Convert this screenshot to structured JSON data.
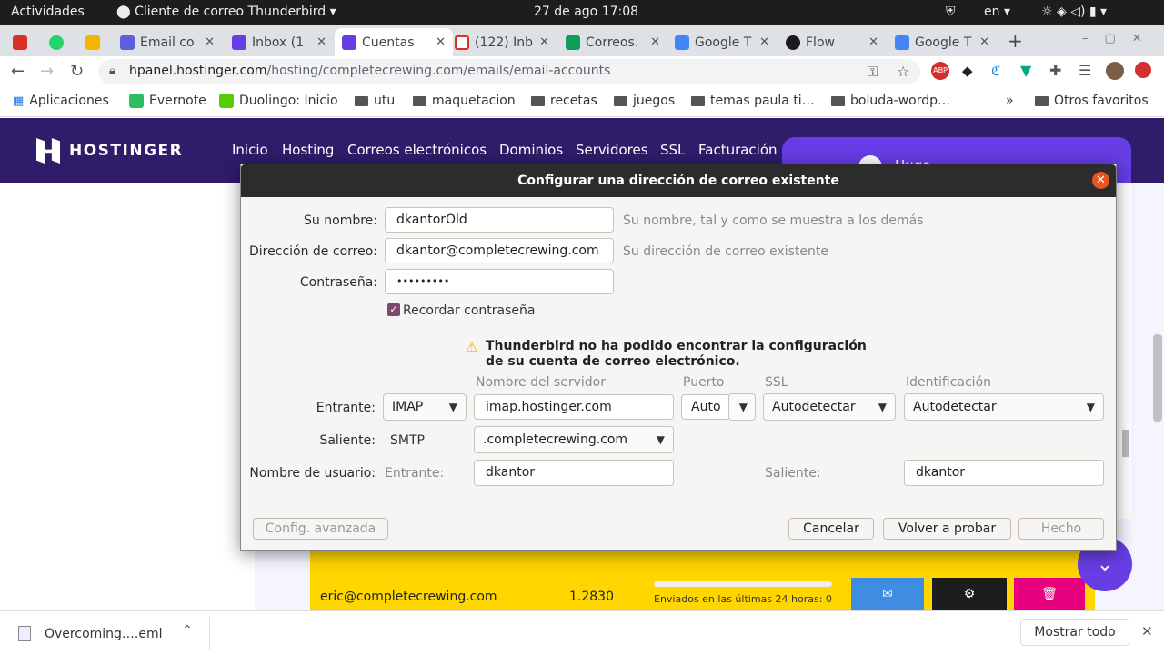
{
  "topbar": {
    "activities": "Actividades",
    "app": "Cliente de correo Thunderbird",
    "clock": "27 de ago  17:08",
    "lang": "en"
  },
  "tabs": [
    {
      "label": "",
      "color": "#d93025"
    },
    {
      "label": "",
      "color": "#25d366"
    },
    {
      "label": "",
      "color": "#f4b400"
    },
    {
      "label": "Email co",
      "color": "#5b5fe0"
    },
    {
      "label": "Inbox (1",
      "color": "#673de6"
    },
    {
      "label": "Cuentas",
      "color": "#673de6"
    },
    {
      "label": "(122) Inb",
      "color": "#d93025"
    },
    {
      "label": "Correos.",
      "color": "#0f9d58"
    },
    {
      "label": "Google T",
      "color": "#4285f4"
    },
    {
      "label": "Flow",
      "color": "#1a1a1a"
    },
    {
      "label": "Google T",
      "color": "#4285f4"
    }
  ],
  "address": {
    "host": "hpanel.hostinger.com",
    "path": "/hosting/completecrewing.com/emails/email-accounts"
  },
  "bookmarks": [
    "Aplicaciones",
    "Evernote",
    "Duolingo: Inicio",
    "utu",
    "maquetacion",
    "recetas",
    "juegos",
    "temas paula ti…",
    "boluda-wordp…",
    "Otros favoritos"
  ],
  "hostinger": {
    "logo": "HOSTINGER",
    "nav": [
      "Inicio",
      "Hosting",
      "Correos electrónicos",
      "Dominios",
      "Servidores",
      "SSL",
      "Facturación"
    ],
    "user": "Hugo",
    "row": {
      "email": "eric@completecrewing.com",
      "value": "1.2830",
      "sent": "Enviados en las últimas 24 horas: 0"
    }
  },
  "dialog": {
    "title": "Configurar una dirección de correo existente",
    "name_label": "Su nombre:",
    "name_value": "dkantorOld",
    "name_hint": "Su nombre, tal y como se muestra a los demás",
    "email_label": "Dirección de correo:",
    "email_value": "dkantor@completecrewing.com",
    "email_hint": "Su dirección de correo existente",
    "pass_label": "Contraseña:",
    "pass_value": "•••••••••",
    "remember": "Recordar contraseña",
    "warning": "Thunderbird no ha podido encontrar la configuración de su cuenta de correo electrónico.",
    "col_server": "Nombre del servidor",
    "col_port": "Puerto",
    "col_ssl": "SSL",
    "col_auth": "Identificación",
    "incoming_label": "Entrante:",
    "incoming_proto": "IMAP",
    "incoming_server": "imap.hostinger.com",
    "incoming_port": "Auto",
    "incoming_ssl": "Autodetectar",
    "incoming_auth": "Autodetectar",
    "outgoing_label": "Saliente:",
    "outgoing_proto": "SMTP",
    "outgoing_server": ".completecrewing.com",
    "user_label": "Nombre de usuario:",
    "user_in_label": "Entrante:",
    "user_in": "dkantor",
    "user_out_label": "Saliente:",
    "user_out": "dkantor",
    "btn_advanced": "Config. avanzada",
    "btn_cancel": "Cancelar",
    "btn_retry": "Volver a probar",
    "btn_done": "Hecho"
  },
  "downloads": {
    "file": "Overcoming….eml",
    "show_all": "Mostrar todo"
  }
}
